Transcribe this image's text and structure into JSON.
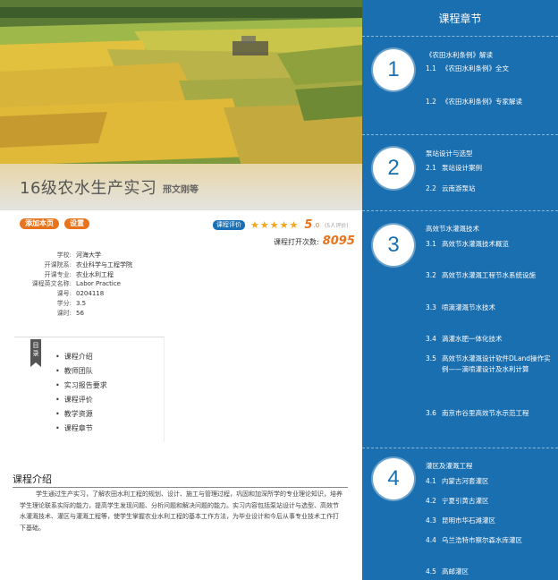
{
  "course": {
    "title": "16级农水生产实习",
    "subtitle": "邢文刚等"
  },
  "actions": {
    "add_to_my_page": "添加本页",
    "settings": "设置"
  },
  "rating": {
    "badge": "课程评价",
    "stars": "★★★★★",
    "score": "5",
    "score_unit": ".0",
    "count": "(5人评价)"
  },
  "views": {
    "label": "课程打开次数:",
    "count": "8095"
  },
  "info": [
    {
      "k": "学校:",
      "v": "河海大学"
    },
    {
      "k": "开课院系:",
      "v": "农业科学与工程学院"
    },
    {
      "k": "开课专业:",
      "v": "农业水利工程"
    },
    {
      "k": "课程英文名称:",
      "v": "Labor Practice"
    },
    {
      "k": "课号:",
      "v": "0204118"
    },
    {
      "k": "学分:",
      "v": "3.5"
    },
    {
      "k": "课时:",
      "v": "56"
    }
  ],
  "toc": {
    "tab": "目录",
    "items": [
      "课程介绍",
      "教师团队",
      "实习报告要求",
      "课程评价",
      "教学资源",
      "课程章节"
    ]
  },
  "intro": {
    "heading": "课程介绍",
    "text": "学生通过生产实习，了解农田水利工程的规划、设计、施工与管理过程，巩固和加深所学的专业理论知识，培养学生理论联系实际的能力，提高学生发现问题、分析问题和解决问题的能力。实习内容包括泵站设计与选型、高效节水灌溉技术、灌区与灌溉工程等，使学生掌握农业水利工程的基本工作方法，为毕业设计和今后从事专业技术工作打下基础。"
  },
  "sidebar": {
    "title": "课程章节",
    "chapters": [
      {
        "num": "1",
        "title": "《农田水利条例》解读",
        "sections": [
          {
            "n": "1.1",
            "t": "《农田水利条例》全文"
          },
          {
            "n": "1.2",
            "t": "《农田水利条例》专家解读"
          }
        ]
      },
      {
        "num": "2",
        "title": "泵站设计与选型",
        "sections": [
          {
            "n": "2.1",
            "t": "泵站设计案例"
          },
          {
            "n": "2.2",
            "t": "云南游泵站"
          }
        ]
      },
      {
        "num": "3",
        "title": "高效节水灌溉技术",
        "sections": [
          {
            "n": "3.1",
            "t": "高效节水灌溉技术概览"
          },
          {
            "n": "3.2",
            "t": "高效节水灌溉工程节水系统设施"
          },
          {
            "n": "3.3",
            "t": "喷滴灌溉节水技术"
          },
          {
            "n": "3.4",
            "t": "滴灌水肥一体化技术"
          },
          {
            "n": "3.5",
            "t": "高效节水灌溉设计软件DLand操作实例——滴喷灌设计及水利计算"
          },
          {
            "n": "3.6",
            "t": "南京市谷里高效节水示范工程"
          }
        ]
      },
      {
        "num": "4",
        "title": "灌区及灌溉工程",
        "sections": [
          {
            "n": "4.1",
            "t": "内蒙古河套灌区"
          },
          {
            "n": "4.2",
            "t": "宁夏引黄古灌区"
          },
          {
            "n": "4.3",
            "t": "昆明市华石滩灌区"
          },
          {
            "n": "4.4",
            "t": "乌兰浩特市察尔森水库灌区"
          },
          {
            "n": "4.5",
            "t": "高邮灌区"
          }
        ]
      }
    ]
  }
}
